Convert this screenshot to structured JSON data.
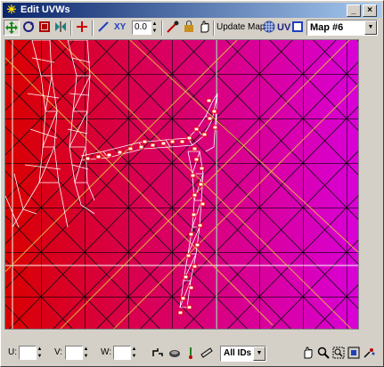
{
  "window": {
    "title": "Edit UVWs"
  },
  "toolbar": {
    "axis_label": "XY",
    "rotation_value": "0.0",
    "update_map_label": "Update Map",
    "uv_label": "UV",
    "map_selector_value": "Map #6"
  },
  "statusbar": {
    "u_label": "U:",
    "v_label": "V:",
    "w_label": "W:",
    "ids_selector_value": "All IDs"
  },
  "colors": {
    "title_active": "#0a246a",
    "vertex_red": "#e00000",
    "mesh_white": "#ffffff",
    "bounds_yellow": "#e0c040"
  },
  "icons": [
    "editor-icon",
    "move-icon",
    "rotate-icon",
    "scale-icon",
    "mirror-icon",
    "add-vertex-icon",
    "draw-line-icon",
    "weld-icon",
    "lock-icon",
    "free-form-icon",
    "checker-icon",
    "show-map-icon",
    "hand-pan-icon",
    "zoom-icon",
    "zoom-region-icon",
    "zoom-extents-icon",
    "filter-icon",
    "break-icon",
    "rotate-cw-icon",
    "rotate-ccw-icon",
    "snap-icon"
  ]
}
